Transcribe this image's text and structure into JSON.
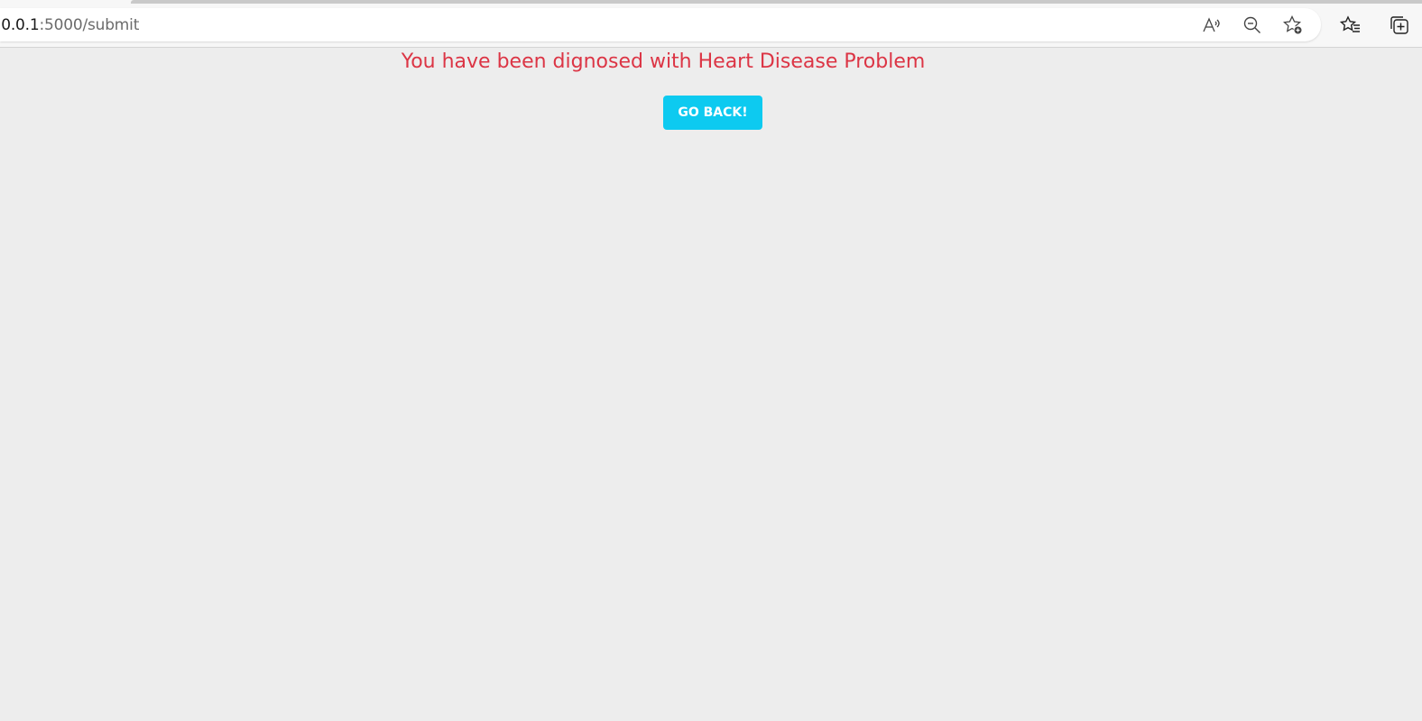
{
  "browser": {
    "url_host": ".0.0.1",
    "url_path": ":5000/submit",
    "icons": [
      "read-aloud-icon",
      "zoom-out-icon",
      "add-favorite-icon",
      "favorites-icon",
      "collections-icon"
    ]
  },
  "page": {
    "result_message": "You have been dignosed with Heart Disease Problem",
    "back_button_label": "GO BACK!"
  },
  "colors": {
    "background": "#ededed",
    "result_text": "#dc3545",
    "button": "#0dcaf0"
  }
}
